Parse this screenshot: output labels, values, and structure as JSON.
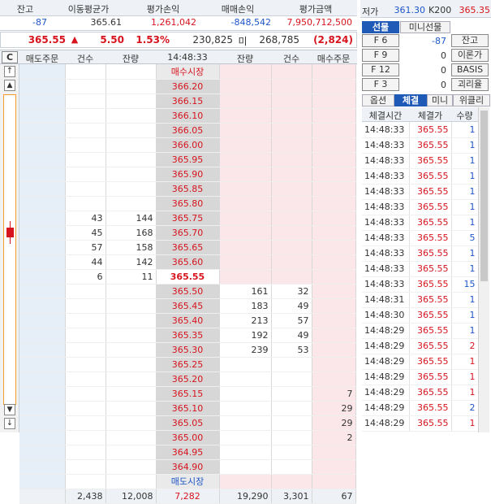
{
  "summary": {
    "headers": [
      "잔고",
      "이동평균가",
      "평가손익",
      "매매손익",
      "평가금액"
    ],
    "values": [
      "-87",
      "365.61",
      "1,261,042",
      "-848,542",
      "7,950,712,500"
    ]
  },
  "quote": {
    "price": "365.55",
    "direction": "▲",
    "change": "5.50",
    "change_pct": "1.53%",
    "volume": "230,825",
    "unit": "미",
    "open_interest": "268,785",
    "oi_change": "(2,824)"
  },
  "ob_header": {
    "c_label": "C",
    "col_sell_order": "매도주문",
    "col_count": "건수",
    "col_qty": "잔량",
    "time": "14:48:33",
    "col_qty2": "잔량",
    "col_count2": "건수",
    "col_buy_order": "매수주문"
  },
  "ob_labels": {
    "buy_market": "매수시장",
    "sell_market": "매도시장"
  },
  "orderbook": {
    "ask_rows": [
      {
        "count": "",
        "qty": "",
        "price": "366.20"
      },
      {
        "count": "",
        "qty": "",
        "price": "366.15"
      },
      {
        "count": "",
        "qty": "",
        "price": "366.10"
      },
      {
        "count": "",
        "qty": "",
        "price": "366.05"
      },
      {
        "count": "",
        "qty": "",
        "price": "366.00"
      },
      {
        "count": "",
        "qty": "",
        "price": "365.95"
      },
      {
        "count": "",
        "qty": "",
        "price": "365.90"
      },
      {
        "count": "",
        "qty": "",
        "price": "365.85"
      },
      {
        "count": "",
        "qty": "",
        "price": "365.80"
      },
      {
        "count": "43",
        "qty": "144",
        "price": "365.75"
      },
      {
        "count": "45",
        "qty": "168",
        "price": "365.70"
      },
      {
        "count": "57",
        "qty": "158",
        "price": "365.65"
      },
      {
        "count": "44",
        "qty": "142",
        "price": "365.60"
      },
      {
        "count": "6",
        "qty": "11",
        "price": "365.55"
      }
    ],
    "bid_rows": [
      {
        "price": "365.50",
        "qty": "161",
        "count": "32",
        "buy": ""
      },
      {
        "price": "365.45",
        "qty": "183",
        "count": "49",
        "buy": ""
      },
      {
        "price": "365.40",
        "qty": "213",
        "count": "57",
        "buy": ""
      },
      {
        "price": "365.35",
        "qty": "192",
        "count": "49",
        "buy": ""
      },
      {
        "price": "365.30",
        "qty": "239",
        "count": "53",
        "buy": ""
      },
      {
        "price": "365.25",
        "qty": "",
        "count": "",
        "buy": ""
      },
      {
        "price": "365.20",
        "qty": "",
        "count": "",
        "buy": ""
      },
      {
        "price": "365.15",
        "qty": "",
        "count": "",
        "buy": "7"
      },
      {
        "price": "365.10",
        "qty": "",
        "count": "",
        "buy": "29"
      },
      {
        "price": "365.05",
        "qty": "",
        "count": "",
        "buy": "29"
      },
      {
        "price": "365.00",
        "qty": "",
        "count": "",
        "buy": "2"
      },
      {
        "price": "364.95",
        "qty": "",
        "count": "",
        "buy": ""
      },
      {
        "price": "364.90",
        "qty": "",
        "count": "",
        "buy": ""
      }
    ],
    "totals": {
      "ask_count": "2,438",
      "ask_qty": "12,008",
      "diff": "7,282",
      "bid_qty": "19,290",
      "bid_count": "3,301",
      "buy_total": "67"
    }
  },
  "side": {
    "low_label": "저가",
    "low_value": "361.30",
    "k200_label": "K200",
    "k200_value": "365.35",
    "tabs_top": [
      "선물",
      "미니선물"
    ],
    "fkeys": [
      {
        "key": "F 6",
        "value": "-87",
        "btn": "잔고"
      },
      {
        "key": "F 9",
        "value": "0",
        "btn": "이론가"
      },
      {
        "key": "F 12",
        "value": "0",
        "btn": "BASIS"
      },
      {
        "key": "F 3",
        "value": "0",
        "btn": "괴리율"
      }
    ],
    "tabs_bottom": [
      "옵션",
      "체결",
      "미니",
      "위클리"
    ],
    "tick_headers": [
      "체결시간",
      "체결가",
      "수량"
    ],
    "ticks": [
      {
        "time": "14:48:33",
        "price": "365.55",
        "qty": "1",
        "color": "blue"
      },
      {
        "time": "14:48:33",
        "price": "365.55",
        "qty": "1",
        "color": "blue"
      },
      {
        "time": "14:48:33",
        "price": "365.55",
        "qty": "1",
        "color": "blue"
      },
      {
        "time": "14:48:33",
        "price": "365.55",
        "qty": "1",
        "color": "blue"
      },
      {
        "time": "14:48:33",
        "price": "365.55",
        "qty": "1",
        "color": "blue"
      },
      {
        "time": "14:48:33",
        "price": "365.55",
        "qty": "1",
        "color": "blue"
      },
      {
        "time": "14:48:33",
        "price": "365.55",
        "qty": "1",
        "color": "blue"
      },
      {
        "time": "14:48:33",
        "price": "365.55",
        "qty": "5",
        "color": "blue"
      },
      {
        "time": "14:48:33",
        "price": "365.55",
        "qty": "1",
        "color": "blue"
      },
      {
        "time": "14:48:33",
        "price": "365.55",
        "qty": "1",
        "color": "blue"
      },
      {
        "time": "14:48:33",
        "price": "365.55",
        "qty": "15",
        "color": "blue"
      },
      {
        "time": "14:48:31",
        "price": "365.55",
        "qty": "1",
        "color": "blue"
      },
      {
        "time": "14:48:30",
        "price": "365.55",
        "qty": "1",
        "color": "blue"
      },
      {
        "time": "14:48:29",
        "price": "365.55",
        "qty": "1",
        "color": "blue"
      },
      {
        "time": "14:48:29",
        "price": "365.55",
        "qty": "2",
        "color": "red"
      },
      {
        "time": "14:48:29",
        "price": "365.55",
        "qty": "1",
        "color": "red"
      },
      {
        "time": "14:48:29",
        "price": "365.55",
        "qty": "1",
        "color": "red"
      },
      {
        "time": "14:48:29",
        "price": "365.55",
        "qty": "1",
        "color": "red"
      },
      {
        "time": "14:48:29",
        "price": "365.55",
        "qty": "2",
        "color": "blue"
      },
      {
        "time": "14:48:29",
        "price": "365.55",
        "qty": "1",
        "color": "red"
      }
    ]
  },
  "colors": {
    "sell_bg": "#e6eef8",
    "buy_bg": "#fbe7ea",
    "price_bg": "#d7d7d7",
    "accent": "#1f5ab6",
    "up": "#d7141e",
    "down": "#1e56c8"
  }
}
